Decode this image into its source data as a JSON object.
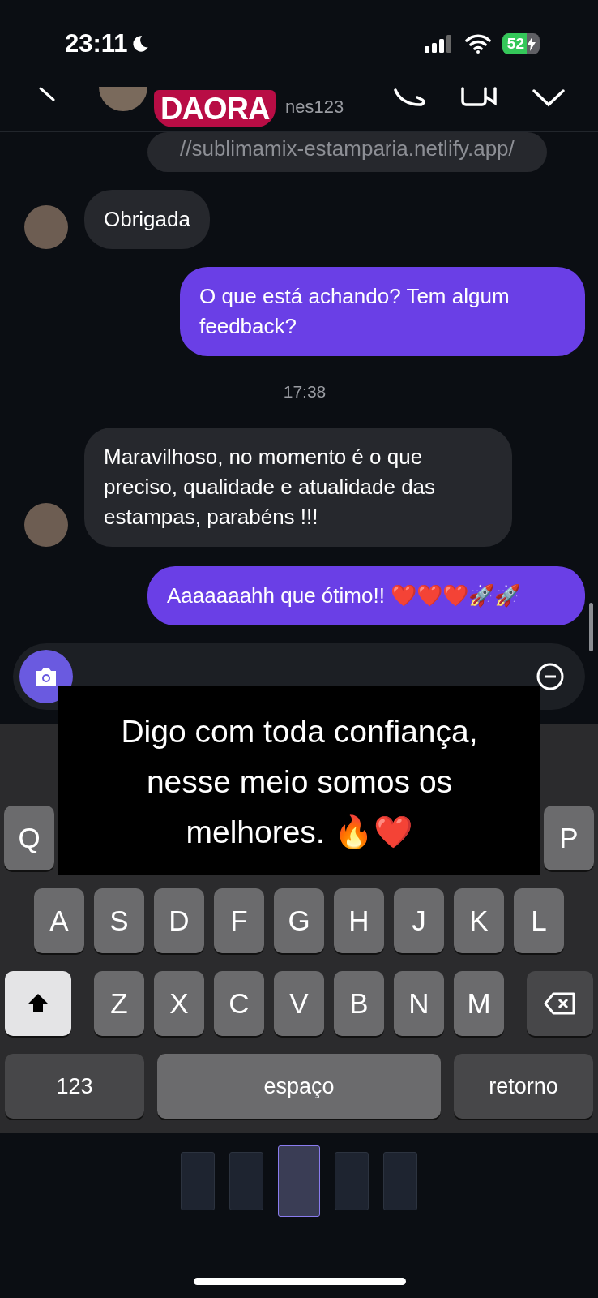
{
  "status_bar": {
    "time": "23:11",
    "battery": "52"
  },
  "header": {
    "username": "nes123",
    "sticker": "DAORA"
  },
  "messages": [
    {
      "kind": "link",
      "text": "//sublimamix-estamparia.netlify.app/"
    },
    {
      "kind": "text",
      "outgoing": false,
      "text": "Obrigada",
      "avatar": true
    },
    {
      "kind": "text",
      "outgoing": true,
      "text": "O que está achando? Tem algum feedback?"
    },
    {
      "kind": "time",
      "text": "17:38"
    },
    {
      "kind": "text",
      "outgoing": false,
      "text": "Maravilhoso, no momento é o que preciso, qualidade e atualidade das estampas, parabéns !!!",
      "avatar": true
    },
    {
      "kind": "text",
      "outgoing": true,
      "text": "Aaaaaaahh que ótimo!! ❤️❤️❤️🚀🚀"
    }
  ],
  "caption": "Digo com toda confiança, nesse meio somos os melhores. 🔥❤️",
  "keyboard": {
    "row1": [
      "Q",
      "P"
    ],
    "row2": [
      "A",
      "S",
      "D",
      "F",
      "G",
      "H",
      "J",
      "K",
      "L"
    ],
    "row3": [
      "Z",
      "X",
      "C",
      "V",
      "B",
      "N",
      "M"
    ],
    "numbers": "123",
    "space": "espaço",
    "return": "retorno"
  },
  "thumbnails": [
    {
      "selected": false
    },
    {
      "selected": false
    },
    {
      "selected": true
    },
    {
      "selected": false
    },
    {
      "selected": false
    }
  ]
}
